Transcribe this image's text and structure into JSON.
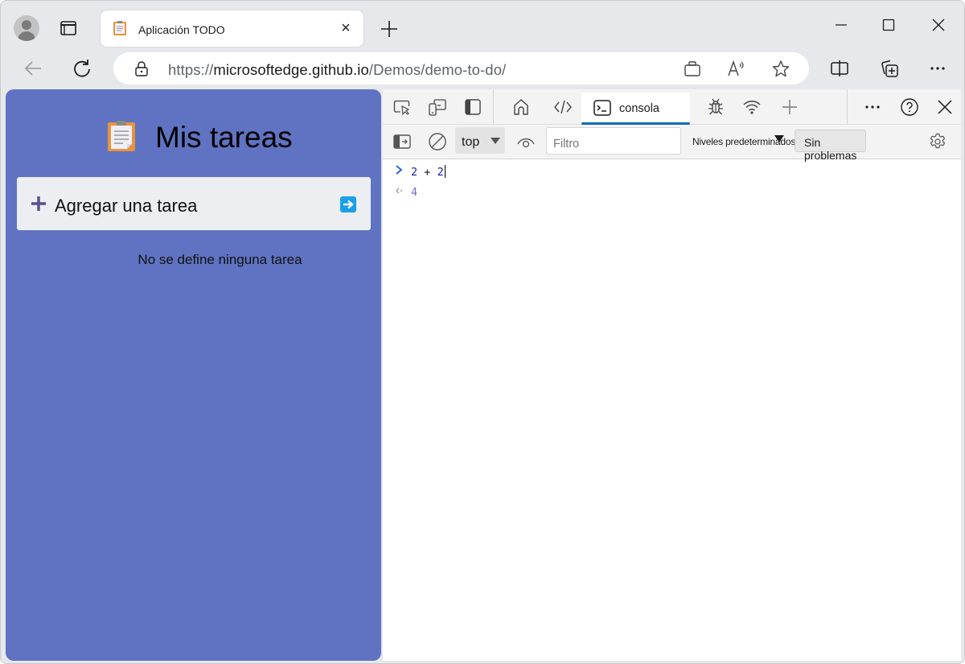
{
  "browser": {
    "tab": {
      "title": "Aplicación TODO",
      "favicon": "clipboard-icon"
    },
    "url": {
      "scheme": "https://",
      "host": "microsoftedge.github.io",
      "path": "/Demos/demo-to-do/"
    },
    "icons": {
      "profile": "avatar-icon",
      "tab_actions": "tab-actions-icon",
      "new_tab": "plus-icon",
      "back": "arrow-left-icon",
      "reload": "refresh-icon",
      "lock": "lock-icon",
      "shopping": "shopping-bag-icon",
      "read_aloud": "read-aloud-icon",
      "favorite": "star-icon",
      "split_screen": "split-screen-icon",
      "collections": "collections-icon",
      "more": "more-icon"
    }
  },
  "app": {
    "title": "Mis tareas",
    "add_task_label": "Agregar una tarea",
    "empty_message": "No se define ninguna tarea",
    "colors": {
      "background": "#5f73c2",
      "submit": "#1aa0e8",
      "plus": "#5c4f8e"
    }
  },
  "devtools": {
    "tabs": [
      {
        "name": "inspect",
        "icon": "inspect-icon"
      },
      {
        "name": "device-emulation",
        "icon": "device-icon"
      },
      {
        "name": "dock",
        "icon": "dock-icon"
      },
      {
        "name": "welcome",
        "icon": "home-icon"
      },
      {
        "name": "elements",
        "icon": "code-icon"
      },
      {
        "name": "console",
        "icon": "console-icon",
        "label": "consola",
        "active": true
      },
      {
        "name": "sources",
        "icon": "bug-icon"
      },
      {
        "name": "network",
        "icon": "wifi-icon"
      },
      {
        "name": "more-tools",
        "icon": "plus-icon"
      }
    ],
    "toolbar": {
      "context": "top",
      "filter_placeholder": "Filtro",
      "levels_label": "Niveles predeterminados",
      "issues_label": "Sin problemas"
    },
    "console": {
      "input": {
        "left": "2",
        "operator": "+",
        "right": "2"
      },
      "result": "4"
    },
    "accent_color": "#0f6cbd"
  }
}
